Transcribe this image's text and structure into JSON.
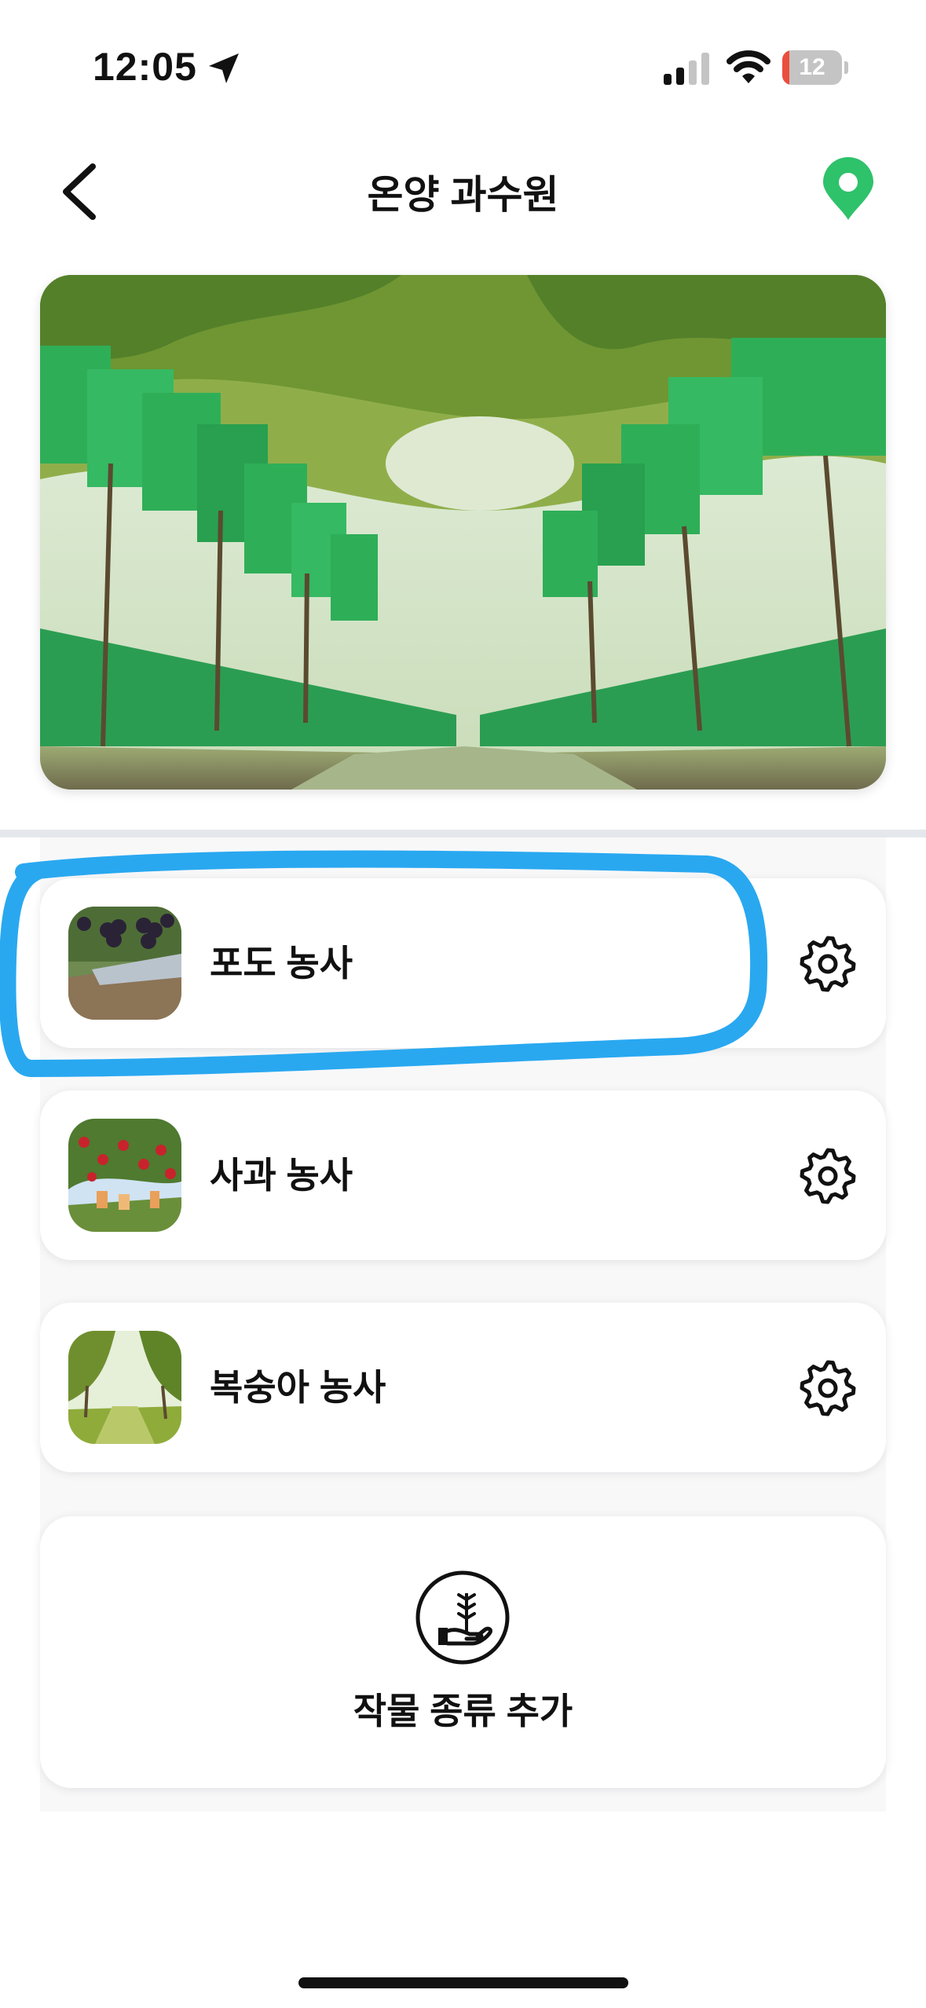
{
  "status_bar": {
    "time": "12:05",
    "battery": "12",
    "battery_color": "#eb4e3d",
    "icons": [
      "location-arrow-icon",
      "cellular-signal-icon",
      "wifi-icon",
      "battery-icon"
    ]
  },
  "nav": {
    "title": "온양 과수원",
    "back_icon": "chevron-left-icon",
    "map_icon": "map-pin-icon",
    "accent_color": "#2ec26a"
  },
  "hero": {
    "image": "grape-vineyard-photo"
  },
  "crops": [
    {
      "name": "포도 농사",
      "thumb": "grape-thumbnail",
      "settings_icon": "gear-icon"
    },
    {
      "name": "사과 농사",
      "thumb": "apple-thumbnail",
      "settings_icon": "gear-icon"
    },
    {
      "name": "복숭아 농사",
      "thumb": "peach-thumbnail",
      "settings_icon": "gear-icon"
    }
  ],
  "add_crop": {
    "label": "작물 종류 추가",
    "icon": "plant-in-hand-icon"
  },
  "annotation": {
    "color": "#29a8f0",
    "shape": "hand-drawn-outline"
  }
}
